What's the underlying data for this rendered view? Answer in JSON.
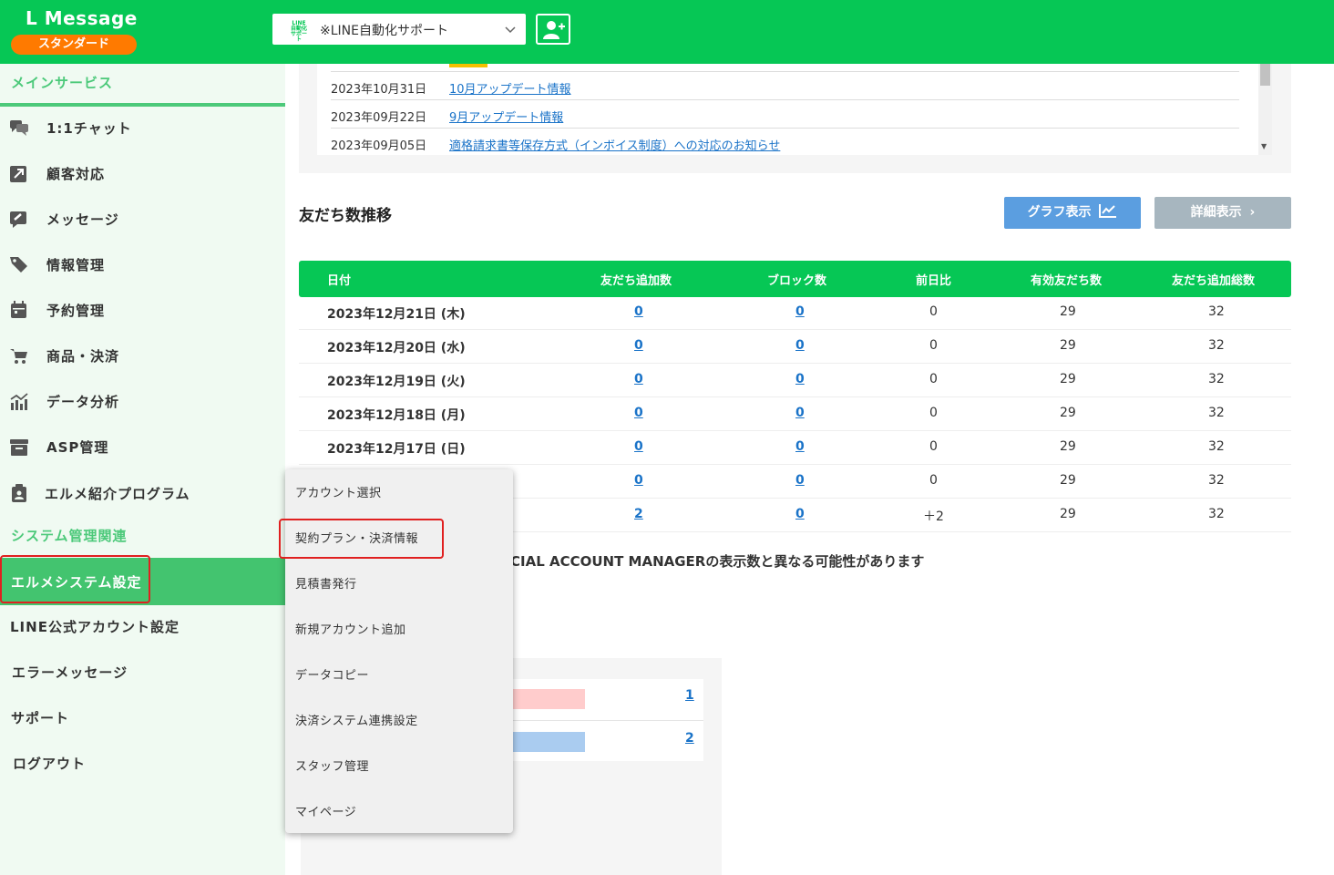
{
  "header": {
    "logo": "L Message",
    "plan": "スタンダード",
    "account_icon_lines": [
      "LINE",
      "自動化",
      "サポート"
    ],
    "account_name": "※LINE自動化サポート"
  },
  "sidebar": {
    "main_section": "メインサービス",
    "main_items": [
      {
        "label": "1:1チャット",
        "icon": "chat-icon"
      },
      {
        "label": "顧客対応",
        "icon": "arrow-icon"
      },
      {
        "label": "メッセージ",
        "icon": "message-icon"
      },
      {
        "label": "情報管理",
        "icon": "tag-icon"
      },
      {
        "label": "予約管理",
        "icon": "calendar-icon"
      },
      {
        "label": "商品・決済",
        "icon": "cart-icon"
      },
      {
        "label": "データ分析",
        "icon": "chart-icon"
      },
      {
        "label": "ASP管理",
        "icon": "box-icon"
      },
      {
        "label": "エルメ紹介プログラム",
        "icon": "clipboard-icon"
      }
    ],
    "system_section": "システム管理関連",
    "system_items": [
      {
        "label": "エルメシステム設定",
        "active": true
      },
      {
        "label": "LINE公式アカウント設定"
      },
      {
        "label": "エラーメッセージ"
      },
      {
        "label": "サポート"
      },
      {
        "label": "ログアウト"
      }
    ]
  },
  "updates": [
    {
      "date": "2023年10月31日",
      "title": "10月アップデート情報"
    },
    {
      "date": "2023年09月22日",
      "title": "9月アップデート情報"
    },
    {
      "date": "2023年09月05日",
      "title": "適格請求書等保存方式（インボイス制度）への対応のお知らせ"
    }
  ],
  "friends": {
    "title": "友だち数推移",
    "graph_button": "グラフ表示",
    "detail_button": "詳細表示",
    "columns": [
      "日付",
      "友だち追加数",
      "ブロック数",
      "前日比",
      "有効友だち数",
      "友だち追加総数"
    ],
    "rows": [
      {
        "date": "2023年12月21日 (木)",
        "added": "0",
        "blocked": "0",
        "diff": "0",
        "active": "29",
        "total": "32"
      },
      {
        "date": "2023年12月20日 (水)",
        "added": "0",
        "blocked": "0",
        "diff": "0",
        "active": "29",
        "total": "32"
      },
      {
        "date": "2023年12月19日 (火)",
        "added": "0",
        "blocked": "0",
        "diff": "0",
        "active": "29",
        "total": "32"
      },
      {
        "date": "2023年12月18日 (月)",
        "added": "0",
        "blocked": "0",
        "diff": "0",
        "active": "29",
        "total": "32"
      },
      {
        "date": "2023年12月17日 (日)",
        "added": "0",
        "blocked": "0",
        "diff": "0",
        "active": "29",
        "total": "32"
      },
      {
        "date": "",
        "added": "0",
        "blocked": "0",
        "diff": "0",
        "active": "29",
        "total": "32"
      },
      {
        "date": "",
        "added": "2",
        "blocked": "0",
        "diff": "＋2",
        "active": "29",
        "total": "32"
      }
    ],
    "note": "CIAL ACCOUNT MANAGERの表示数と異なる可能性があります"
  },
  "bars": [
    {
      "count": "1",
      "color": "#ffcccc"
    },
    {
      "count": "2",
      "color": "#aaccf0"
    }
  ],
  "dropdown": {
    "items": [
      "アカウント選択",
      "契約プラン・決済情報",
      "見積書発行",
      "新規アカウント追加",
      "データコピー",
      "決済システム連携設定",
      "スタッフ管理",
      "マイページ"
    ],
    "highlighted": "契約プラン・決済情報"
  },
  "colors": {
    "brand_green": "#06c755",
    "plan_orange": "#ff7a00",
    "link_blue": "#1a73c8",
    "highlight_red": "#e02020"
  }
}
